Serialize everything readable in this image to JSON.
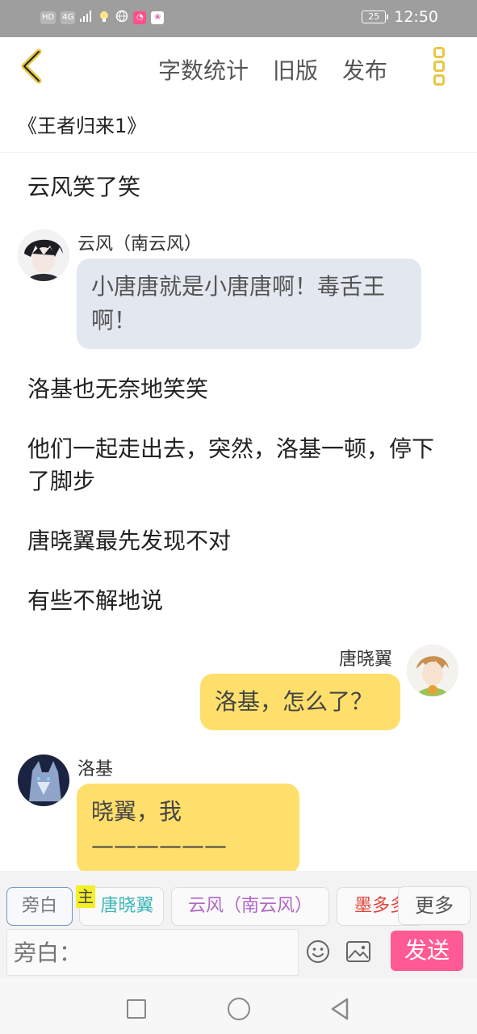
{
  "status_bar": {
    "hd": "HD",
    "network": "4G",
    "battery": "25",
    "time": "12:50"
  },
  "toolbar": {
    "word_count": "字数统计",
    "old_version": "旧版",
    "publish": "发布"
  },
  "book_title": "《王者归来1》",
  "messages": [
    {
      "type": "narration",
      "text": "云风笑了笑"
    },
    {
      "type": "chat",
      "side": "left",
      "speaker": "云风（南云风）",
      "text": "小唐唐就是小唐唐啊！毒舌王啊！",
      "bubble_color": "#e3e8f0"
    },
    {
      "type": "narration",
      "text": "洛基也无奈地笑笑"
    },
    {
      "type": "narration",
      "text": "他们一起走出去，突然，洛基一顿，停下了脚步"
    },
    {
      "type": "narration",
      "text": "唐晓翼最先发现不对"
    },
    {
      "type": "narration",
      "text": "有些不解地说"
    },
    {
      "type": "chat",
      "side": "right",
      "speaker": "唐晓翼",
      "text": "洛基，怎么了？",
      "bubble_color": "#ffdf6b"
    },
    {
      "type": "chat",
      "side": "left",
      "speaker": "洛基",
      "text": "晓翼，我——————",
      "bubble_color": "#ffdf6b"
    }
  ],
  "role_chips": [
    {
      "label": "旁白",
      "color": "#777777",
      "active": true
    },
    {
      "label": "唐晓翼",
      "color": "#3fb6b8",
      "active": false
    },
    {
      "label": "云风（南云风）",
      "color": "#b066c4",
      "active": false
    },
    {
      "label": "墨多多",
      "color": "#e0463a",
      "active": false
    }
  ],
  "main_badge": "主",
  "more_label": "更多",
  "input": {
    "placeholder": "旁白："
  },
  "send_label": "发送",
  "colors": {
    "accent_yellow": "#e6c844",
    "send_pink": "#ff5a94"
  },
  "icons": [
    "back-arrow-icon",
    "more-vertical-icon",
    "emoji-icon",
    "image-icon",
    "nav-recent-icon",
    "nav-home-icon",
    "nav-back-icon"
  ]
}
